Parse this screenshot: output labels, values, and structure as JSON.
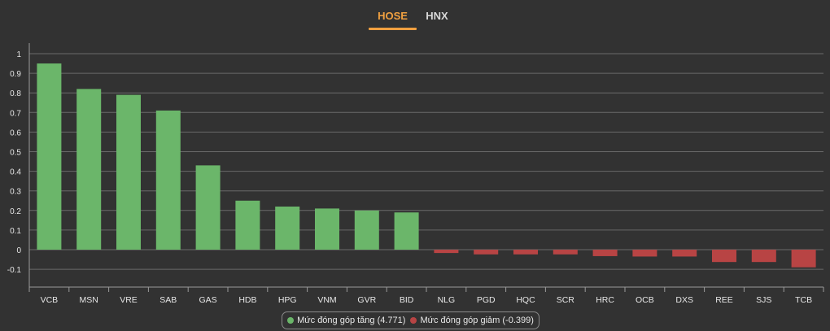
{
  "tabs": [
    {
      "label": "HOSE",
      "active": true
    },
    {
      "label": "HNX",
      "active": false
    }
  ],
  "colors": {
    "background": "#323232",
    "accent": "#f0a040",
    "positive": "#6bb66a",
    "negative": "#b84444",
    "grid": "#6a6a6a",
    "text": "#e6e6e6"
  },
  "legend": {
    "increase_label": "Mức đóng góp tăng (4.771)",
    "decrease_label": "Mức đóng góp giảm (-0.399)"
  },
  "chart_data": {
    "type": "bar",
    "categories": [
      "VCB",
      "MSN",
      "VRE",
      "SAB",
      "GAS",
      "HDB",
      "HPG",
      "VNM",
      "GVR",
      "BID",
      "NLG",
      "PGD",
      "HQC",
      "SCR",
      "HRC",
      "OCB",
      "DXS",
      "REE",
      "SJS",
      "TCB"
    ],
    "values": [
      0.95,
      0.82,
      0.79,
      0.71,
      0.43,
      0.25,
      0.22,
      0.21,
      0.2,
      0.19,
      -0.017,
      -0.024,
      -0.024,
      -0.024,
      -0.033,
      -0.035,
      -0.035,
      -0.063,
      -0.063,
      -0.09
    ],
    "yticks": [
      "1",
      "0.9",
      "0.8",
      "0.7",
      "0.6",
      "0.5",
      "0.4",
      "0.3",
      "0.2",
      "0.1",
      "0",
      "-0.1"
    ],
    "ylim": [
      -0.1,
      1
    ],
    "grid": true,
    "legend_position": "bottom-center",
    "title": "",
    "xlabel": "",
    "ylabel": ""
  }
}
